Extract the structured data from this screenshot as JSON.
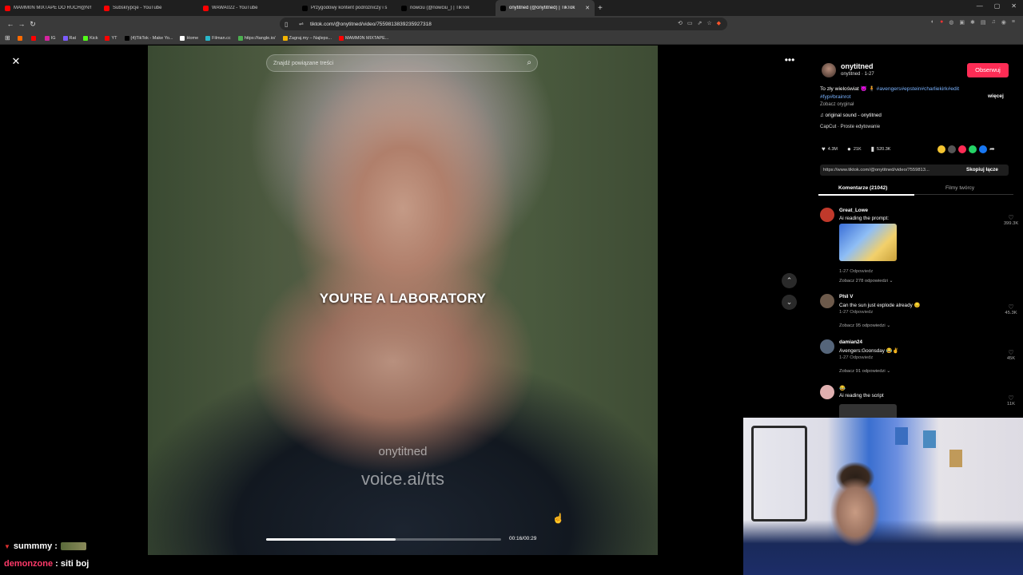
{
  "browser": {
    "tabs": [
      {
        "title": "MAMM0N MIXTAPE DO RUCH@N!!",
        "icon_color": "#ff0000"
      },
      {
        "title": "Subskrypcje - YouTube",
        "icon_color": "#ff0000"
      },
      {
        "title": "WAWA022 - YouTube",
        "icon_color": "#ff0000"
      },
      {
        "title": "Przygodowy kontent podróżniczy i s",
        "icon_color": "#000000"
      },
      {
        "title": "nowciu (@nowciu_) | TikTok",
        "icon_color": "#000000"
      },
      {
        "title": "onytitned (@onytitned) | TikTok",
        "icon_color": "#000000",
        "active": true
      }
    ],
    "new_tab": "+",
    "url": "tiktok.com/@onytitned/video/7559813839235927318",
    "bookmarks": [
      {
        "label": "",
        "color": "#ff6a00"
      },
      {
        "label": "",
        "color": "#ff0000"
      },
      {
        "label": "IG",
        "color": "#d6249f"
      },
      {
        "label": "Rat",
        "color": "#7b5cff"
      },
      {
        "label": "Kick",
        "color": "#53fc18"
      },
      {
        "label": "YT",
        "color": "#ff0000"
      },
      {
        "label": "(4)TikTok - Make Yo...",
        "color": "#000000"
      },
      {
        "label": "Home",
        "color": "#ffffff"
      },
      {
        "label": "Filman.cc",
        "color": "#2ab7ca"
      },
      {
        "label": "https://tangle.io/",
        "color": "#4caf50"
      },
      {
        "label": "Zagraj.my – Najleps...",
        "color": "#f4b400"
      },
      {
        "label": "MAMM0N MIXTAPE...",
        "color": "#ff0000"
      }
    ]
  },
  "video": {
    "search_placeholder": "Znajdź powiązane treści",
    "caption": "YOU'RE A LABORATORY",
    "watermark_user": "onytitned",
    "watermark_tts": "voice.ai/tts",
    "time": "00:16/00:29",
    "progress": 0.55
  },
  "panel": {
    "username": "onytitned",
    "subline": "onytitned · 1-27",
    "follow_label": "Obserwuj",
    "desc_text": "To zły wieloświat 😈 🧍 ",
    "desc_tags": "#avengers#epstein#charliekirk#edit #fyp#brainrot",
    "more_label": "więcej",
    "translate": "Zobacz oryginał",
    "sound": "♫  original sound - onytitned",
    "capcut": "CapCut · Proste edytowanie",
    "likes": "4.3M",
    "comments": "21K",
    "saves": "520.3K",
    "link": "https://www.tiktok.com/@onytitned/video/7559813...",
    "copy_label": "Skopiuj łącze",
    "tab_comments": "Komentarze (21042)",
    "tab_creator": "Filmy twórcy"
  },
  "comments": [
    {
      "user": "Great_Lowe",
      "text": "Ai reading the prompt:",
      "meta": "1-27    Odpowiedz",
      "replies": "Zobacz 278 odpowiedzi ⌄",
      "likes": "399.3K",
      "avatar": "#c0392b"
    },
    {
      "user": "Phil V",
      "text": "Can the sun just explode already 😔",
      "meta": "1-27    Odpowiedz",
      "replies": "Zobacz 95 odpowiedzi ⌄",
      "likes": "45.3K",
      "avatar": "#6d5a4b"
    },
    {
      "user": "damian24",
      "text": "Avengers:Goonsday 😂✌",
      "meta": "1-27    Odpowiedz",
      "replies": "Zobacz 91 odpowiedzi ⌄",
      "likes": "45K",
      "avatar": "#55657a"
    },
    {
      "user": "😂",
      "text": "Ai reading the script",
      "meta": "",
      "replies": "",
      "likes": "11K",
      "avatar": "#e0b0b0"
    }
  ],
  "chat": [
    {
      "user": "summmy",
      "sep": " :",
      "text": ""
    },
    {
      "user": "demonzone",
      "sep": " : ",
      "text": "siti boj"
    }
  ]
}
